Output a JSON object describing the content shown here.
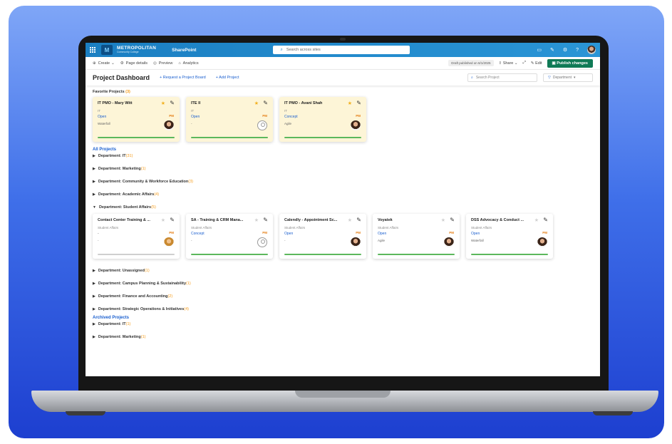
{
  "suite": {
    "org_name": "METROPOLITAN",
    "org_sub": "Community College",
    "app": "SharePoint",
    "search_placeholder": "Search across sites"
  },
  "commands": {
    "create": "Create",
    "page_details": "Page details",
    "preview": "Preview",
    "analytics": "Analytics",
    "draft": "Draft published on 6/1/2025",
    "share": "Share",
    "edit": "Edit",
    "publish": "Publish changes"
  },
  "header": {
    "title": "Project Dashboard",
    "request": "+ Request a Project Board",
    "add": "+ Add Project",
    "search_placeholder": "Search Project",
    "filter": "Department"
  },
  "favorites": {
    "label": "Favorite Projects",
    "count": "(3)",
    "cards": [
      {
        "title": "IT PMO - Mary Witt",
        "dept": "IT",
        "status": "Open",
        "method": "Waterfall",
        "pm": "PM"
      },
      {
        "title": "ITE II",
        "dept": "IT",
        "status": "Open",
        "method": "-",
        "pm": "PM"
      },
      {
        "title": "IT PMO - Avani Shah",
        "dept": "IT",
        "status": "Concept",
        "method": "Agile",
        "pm": "PM"
      }
    ]
  },
  "all_projects": {
    "label": "All Projects",
    "departments_before": [
      {
        "name": "Department: IT",
        "count": "(31)"
      },
      {
        "name": "Department: Marketing",
        "count": "(1)"
      },
      {
        "name": "Department: Community & Workforce Education",
        "count": "(3)"
      },
      {
        "name": "Department: Academic Affairs",
        "count": "(4)"
      }
    ],
    "expanded": {
      "name": "Department: Student Affairs",
      "count": "(5)"
    },
    "student_cards": [
      {
        "title": "Contact Center Training & ...",
        "dept": "Student Affairs",
        "status": "-",
        "method": "-",
        "pm": "PM"
      },
      {
        "title": "SA - Training & CRM Mana...",
        "dept": "Student Affairs",
        "status": "Concept",
        "method": "-",
        "pm": "PM"
      },
      {
        "title": "Calendly - Appointment Sc...",
        "dept": "Student Affairs",
        "status": "Open",
        "method": "-",
        "pm": "PM"
      },
      {
        "title": "Voyatek",
        "dept": "Student Affairs",
        "status": "Open",
        "method": "Agile",
        "pm": "PM"
      },
      {
        "title": "DSS Advocacy & Conduct ...",
        "dept": "Student Affairs",
        "status": "Open",
        "method": "Waterfall",
        "pm": "PM"
      }
    ],
    "departments_after": [
      {
        "name": "Department: Unassigned",
        "count": "(1)"
      },
      {
        "name": "Department: Campus Planning & Sustainability",
        "count": "(1)"
      },
      {
        "name": "Department: Finance and Accounting",
        "count": "(2)"
      },
      {
        "name": "Department: Strategic Operations & Initiatives",
        "count": "(4)"
      }
    ]
  },
  "archived": {
    "label": "Archived Projects",
    "departments": [
      {
        "name": "Department: IT",
        "count": "(1)"
      },
      {
        "name": "Department: Marketing",
        "count": "(1)"
      }
    ]
  }
}
